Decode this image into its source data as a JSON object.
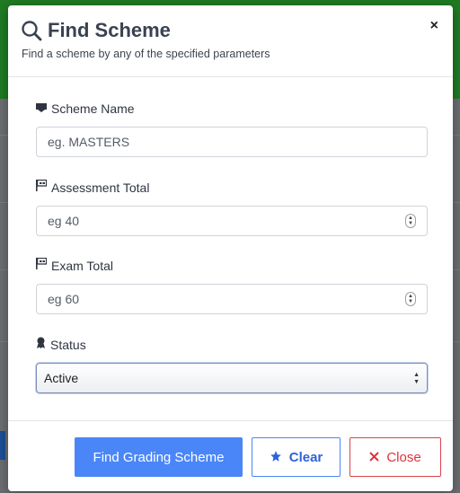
{
  "modal": {
    "title": "Find Scheme",
    "subtitle": "Find a scheme by any of the specified parameters",
    "close_symbol": "×"
  },
  "fields": {
    "scheme_name": {
      "label": "Scheme Name",
      "placeholder": "eg. MASTERS",
      "icon": "bookmark-icon"
    },
    "assessment_total": {
      "label": "Assessment Total",
      "placeholder": "eg 40",
      "icon": "flag-icon"
    },
    "exam_total": {
      "label": "Exam Total",
      "placeholder": "eg 60",
      "icon": "flag-icon"
    },
    "status": {
      "label": "Status",
      "value": "Active",
      "icon": "award-icon"
    }
  },
  "footer": {
    "find_label": "Find Grading Scheme",
    "clear_label": "Clear",
    "close_label": "Close"
  },
  "colors": {
    "primary": "#4a86f7",
    "danger": "#e0313b",
    "title": "#3a4250"
  }
}
